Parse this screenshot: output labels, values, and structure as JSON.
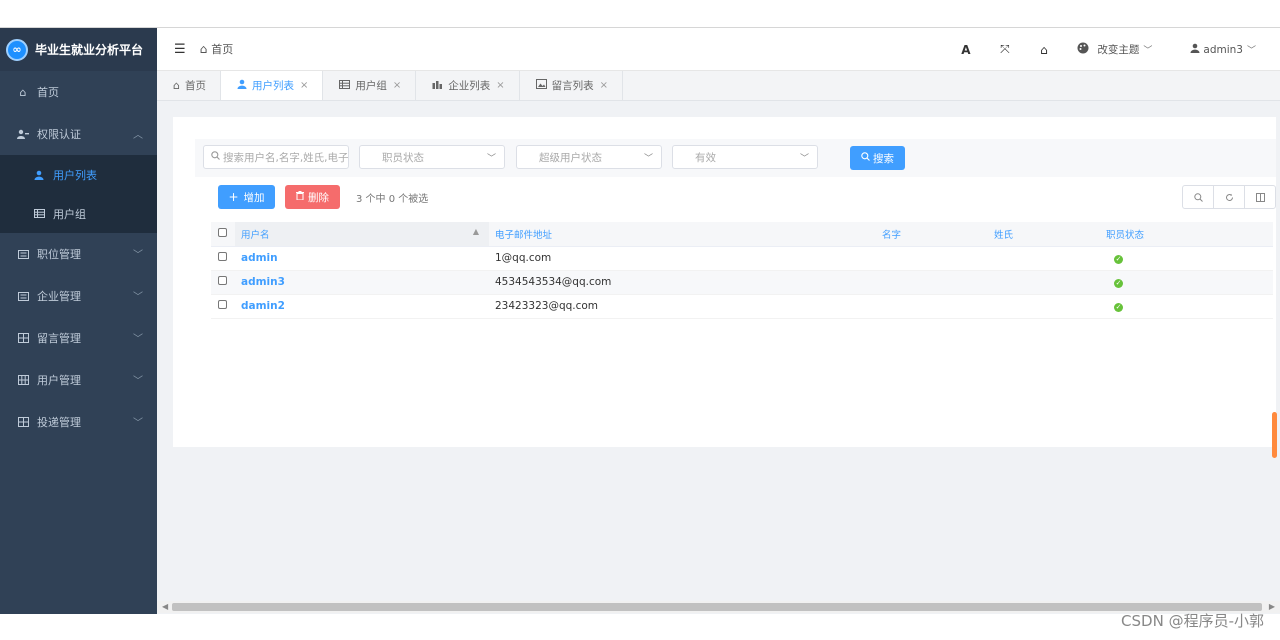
{
  "app": {
    "title": "毕业生就业分析平台",
    "logo_glyph": "∞"
  },
  "sidebar": {
    "items": [
      {
        "label": "首页",
        "icon": "home-icon",
        "expanded": false
      },
      {
        "label": "权限认证",
        "icon": "user-key-icon",
        "expanded": true,
        "children": [
          {
            "label": "用户列表",
            "icon": "user-icon",
            "active": true
          },
          {
            "label": "用户组",
            "icon": "table-icon",
            "active": false
          }
        ]
      },
      {
        "label": "职位管理",
        "icon": "list-icon"
      },
      {
        "label": "企业管理",
        "icon": "list-icon"
      },
      {
        "label": "留言管理",
        "icon": "grid-icon"
      },
      {
        "label": "用户管理",
        "icon": "grid-icon"
      },
      {
        "label": "投递管理",
        "icon": "grid-icon"
      }
    ]
  },
  "navbar": {
    "breadcrumb": "首页",
    "theme_label": "改变主题",
    "user_label": "admin3"
  },
  "tags": [
    {
      "label": "首页",
      "icon": "home-icon",
      "active": false,
      "closable": false
    },
    {
      "label": "用户列表",
      "icon": "user-icon",
      "active": true,
      "closable": true
    },
    {
      "label": "用户组",
      "icon": "table-icon",
      "active": false,
      "closable": true
    },
    {
      "label": "企业列表",
      "icon": "chart-icon",
      "active": false,
      "closable": true
    },
    {
      "label": "留言列表",
      "icon": "image-icon",
      "active": false,
      "closable": true
    }
  ],
  "filter": {
    "search_placeholder": "搜索用户名,名字,姓氏,电子",
    "job_status_placeholder": "职员状态",
    "super_status_placeholder": "超级用户状态",
    "active_placeholder": "有效",
    "search_button": "搜索"
  },
  "toolbar": {
    "add_label": "增加",
    "delete_label": "删除",
    "selection_info": "3 个中 0 个被选"
  },
  "table": {
    "columns": [
      "用户名",
      "电子邮件地址",
      "名字",
      "姓氏",
      "职员状态"
    ],
    "rows": [
      {
        "username": "admin",
        "email": "1@qq.com",
        "first_name": "",
        "last_name": "",
        "staff": true
      },
      {
        "username": "admin3",
        "email": "4534543534@qq.com",
        "first_name": "",
        "last_name": "",
        "staff": true
      },
      {
        "username": "damin2",
        "email": "23423323@qq.com",
        "first_name": "",
        "last_name": "",
        "staff": true
      }
    ]
  },
  "watermark": "CSDN @程序员-小郭",
  "colors": {
    "sidebar_bg": "#304156",
    "accent": "#409eff",
    "danger": "#f56c6c",
    "success": "#67c23a"
  }
}
